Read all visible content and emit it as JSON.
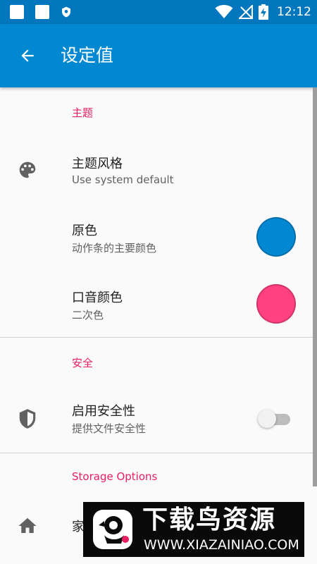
{
  "status_bar": {
    "time": "12:12",
    "icons": [
      "notification-square-icon",
      "notification-square-icon",
      "shield-status-icon",
      "wifi-icon",
      "no-signal-icon",
      "battery-charging-icon"
    ]
  },
  "app_bar": {
    "title": "设定值",
    "back_icon": "arrow-back-icon"
  },
  "sections": {
    "theme": {
      "header": "主题",
      "style": {
        "title": "主题风格",
        "summary": "Use system default",
        "icon": "palette-icon"
      },
      "primary": {
        "title": "原色",
        "summary": "动作条的主要颜色",
        "color": "#0288d1"
      },
      "accent": {
        "title": "口音颜色",
        "summary": "二次色",
        "color": "#ff4081"
      }
    },
    "security": {
      "header": "安全",
      "enable": {
        "title": "启用安全性",
        "summary": "提供文件安全性",
        "icon": "shield-icon",
        "enabled": false
      }
    },
    "storage": {
      "header": "Storage Options",
      "home": {
        "title": "家",
        "icon": "home-icon"
      }
    }
  },
  "colors": {
    "app_bar": "#0288d1",
    "status_bar": "#0277bd",
    "section_header": "#e91e63"
  },
  "watermark": {
    "title": "下载鸟资源",
    "url": "WWW.XIAZAINIAO.COM"
  }
}
